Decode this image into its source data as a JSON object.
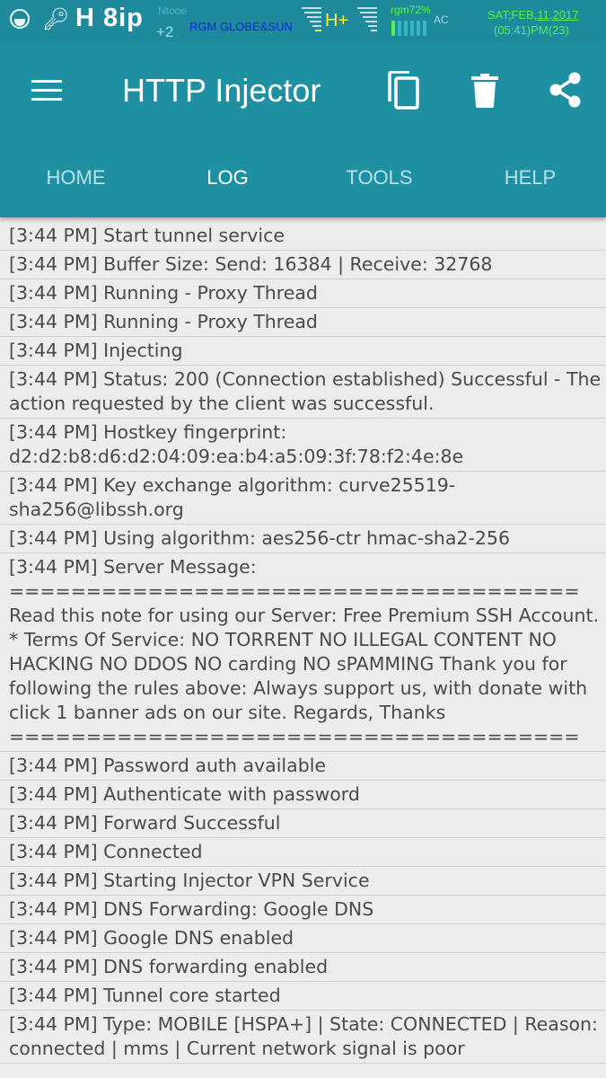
{
  "status_bar": {
    "left_badge": "H 8ip",
    "faint_text": "Ntooe",
    "plus": "+2",
    "carrier": "RGM GLOBE&SUN",
    "network": "H+",
    "battery": "rgm72%",
    "charging": "AC",
    "date_prefix": "SAT;FEB,",
    "date_underlined": "11,2017",
    "time": "(05:41)PM(23)",
    "colors": {
      "background": "#1f8a9b",
      "green": "#53f24f",
      "carrier": "#0b2bd1",
      "network": "#ffef2a"
    }
  },
  "app_bar": {
    "title": "HTTP Injector",
    "icons": [
      "menu-icon",
      "copy-icon",
      "delete-icon",
      "share-icon"
    ],
    "color": "#1e90a2"
  },
  "tabs": [
    {
      "label": "HOME",
      "active": false
    },
    {
      "label": "LOG",
      "active": true
    },
    {
      "label": "TOOLS",
      "active": false
    },
    {
      "label": "HELP",
      "active": false
    }
  ],
  "log": {
    "entries": [
      "[3:44 PM] Start tunnel service",
      "[3:44 PM] Buffer Size: Send: 16384 | Receive: 32768",
      "[3:44 PM] Running - Proxy Thread",
      "[3:44 PM] Running - Proxy Thread",
      "[3:44 PM] Injecting",
      "[3:44 PM] Status: 200 (Connection established) Successful - The action requested by the client was successful.",
      "[3:44 PM] Hostkey fingerprint: d2:d2:b8:d6:d2:04:09:ea:b4:a5:09:3f:78:f2:4e:8e",
      "[3:44 PM] Key exchange algorithm: curve25519-sha256@libssh.org",
      "[3:44 PM] Using algorithm: aes256-ctr hmac-sha2-256",
      "[3:44 PM] Server Message:\n===================================== Read this note for using our Server: Free Premium SSH Account. * Terms Of Service: NO TORRENT NO ILLEGAL CONTENT NO HACKING NO DDOS NO carding NO sPAMMING Thank you for following the rules above: Always support us, with donate with click 1 banner ads on our site. Regards, Thanks\n=====================================",
      "[3:44 PM] Password auth available",
      "[3:44 PM] Authenticate with password",
      "[3:44 PM] Forward Successful",
      "[3:44 PM] Connected",
      "[3:44 PM] Starting Injector VPN Service",
      "[3:44 PM] DNS Forwarding: Google DNS",
      "[3:44 PM] Google DNS enabled",
      "[3:44 PM] DNS forwarding enabled",
      "[3:44 PM] Tunnel core started",
      "[3:44 PM] Type: MOBILE [HSPA+] | State: CONNECTED | Reason: connected | mms | Current network signal is poor"
    ]
  }
}
